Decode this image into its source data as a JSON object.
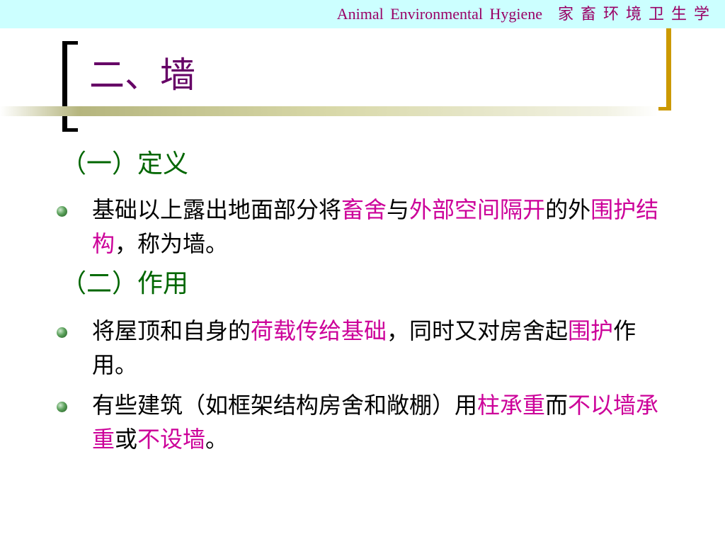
{
  "header": {
    "title_en": "Animal  Environmental  Hygiene",
    "title_cn": "家畜环境卫生学"
  },
  "slide": {
    "title": "二、墙",
    "sections": [
      {
        "heading": "（一）定义",
        "bullets": [
          {
            "segments": [
              {
                "text": "基础以上露出地面部分将",
                "highlight": false
              },
              {
                "text": "畜舍",
                "highlight": true
              },
              {
                "text": "与",
                "highlight": false
              },
              {
                "text": "外部空间隔开",
                "highlight": true
              },
              {
                "text": "的外",
                "highlight": false
              },
              {
                "text": "围护结构",
                "highlight": true
              },
              {
                "text": "，称为墙。",
                "highlight": false
              }
            ]
          }
        ]
      },
      {
        "heading": "（二）作用",
        "bullets": [
          {
            "segments": [
              {
                "text": "将屋顶和自身的",
                "highlight": false
              },
              {
                "text": "荷载传给基础",
                "highlight": true
              },
              {
                "text": "，同时又对房舍起",
                "highlight": false
              },
              {
                "text": "围护",
                "highlight": true
              },
              {
                "text": "作用。",
                "highlight": false
              }
            ]
          },
          {
            "segments": [
              {
                "text": "有些建筑（如框架结构房舍和敞棚）用",
                "highlight": false
              },
              {
                "text": "柱承重",
                "highlight": true
              },
              {
                "text": "而",
                "highlight": false
              },
              {
                "text": "不以墙承重",
                "highlight": true
              },
              {
                "text": "或",
                "highlight": false
              },
              {
                "text": "不设墙",
                "highlight": true
              },
              {
                "text": "。",
                "highlight": false
              }
            ]
          }
        ]
      }
    ]
  },
  "colors": {
    "header_background": "#ccffff",
    "header_text": "#990066",
    "title": "#660066",
    "section_heading": "#006600",
    "highlight": "#cc0099",
    "body_text": "#000000",
    "right_bracket": "#cc9900"
  },
  "icons": {
    "bullet": "green-sphere-bullet-icon"
  }
}
